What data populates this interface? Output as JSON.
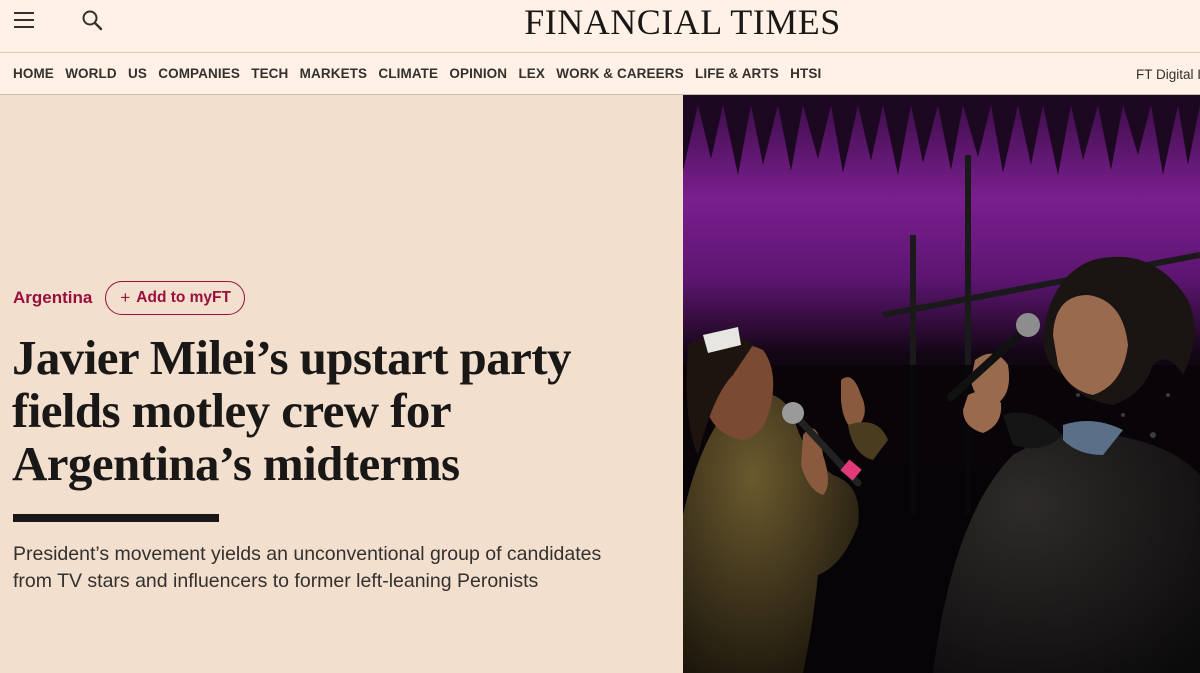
{
  "header": {
    "logo": "FINANCIAL TIMES",
    "menu_icon": "hamburger-menu-icon",
    "search_icon": "search-icon"
  },
  "nav": {
    "items": [
      {
        "label": "HOME"
      },
      {
        "label": "WORLD"
      },
      {
        "label": "US"
      },
      {
        "label": "COMPANIES"
      },
      {
        "label": "TECH"
      },
      {
        "label": "MARKETS"
      },
      {
        "label": "CLIMATE"
      },
      {
        "label": "OPINION"
      },
      {
        "label": "LEX"
      },
      {
        "label": "WORK & CAREERS"
      },
      {
        "label": "LIFE & ARTS"
      },
      {
        "label": "HTSI"
      }
    ],
    "right_link": "FT Digital I"
  },
  "article": {
    "topic": "Argentina",
    "myft_plus": "+",
    "myft_label": "Add to myFT",
    "headline_lines": [
      "Javier Milei’s upstart party",
      "fields motley crew for",
      "Argentina’s midterms"
    ],
    "standfirst_lines": [
      "President’s movement yields an unconventional group of candidates",
      "from TV stars and influencers to former left-leaning Peronists"
    ]
  },
  "colors": {
    "page_background": "#f2dfce",
    "header_background": "#fff1e5",
    "accent_claret": "#990f3d",
    "text_dark": "#1a1817"
  }
}
